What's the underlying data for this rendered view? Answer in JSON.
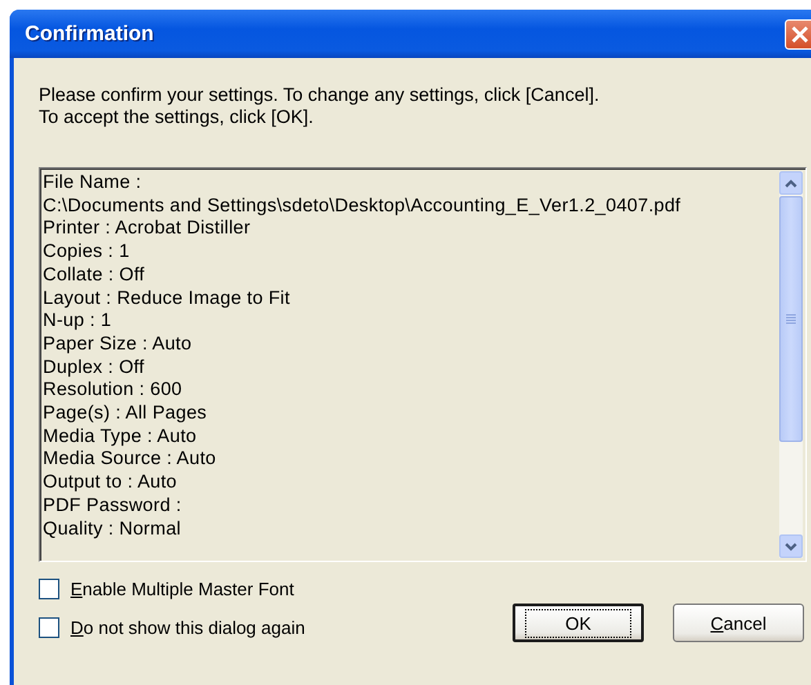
{
  "window": {
    "title": "Confirmation"
  },
  "message": [
    "Please confirm your settings. To change any settings, click [Cancel].",
    "To accept the settings, click [OK]."
  ],
  "settings_list": [
    "File Name :",
    "C:\\Documents and Settings\\sdeto\\Desktop\\Accounting_E_Ver1.2_0407.pdf",
    "Printer : Acrobat Distiller",
    "Copies : 1",
    "Collate : Off",
    "Layout : Reduce Image to Fit",
    "N-up : 1",
    "Paper Size : Auto",
    "Duplex : Off",
    "Resolution : 600",
    "Page(s) : All Pages",
    "Media Type : Auto",
    "Media Source : Auto",
    "Output to : Auto",
    "PDF Password :",
    "Quality : Normal"
  ],
  "checkboxes": [
    {
      "label": "Enable Multiple Master Font",
      "checked": false
    },
    {
      "label": "Do not show this dialog again",
      "checked": false
    }
  ],
  "buttons": [
    {
      "label": "OK",
      "default": true,
      "underline_first": false
    },
    {
      "label": "Cancel",
      "default": false,
      "underline_first": true
    }
  ]
}
